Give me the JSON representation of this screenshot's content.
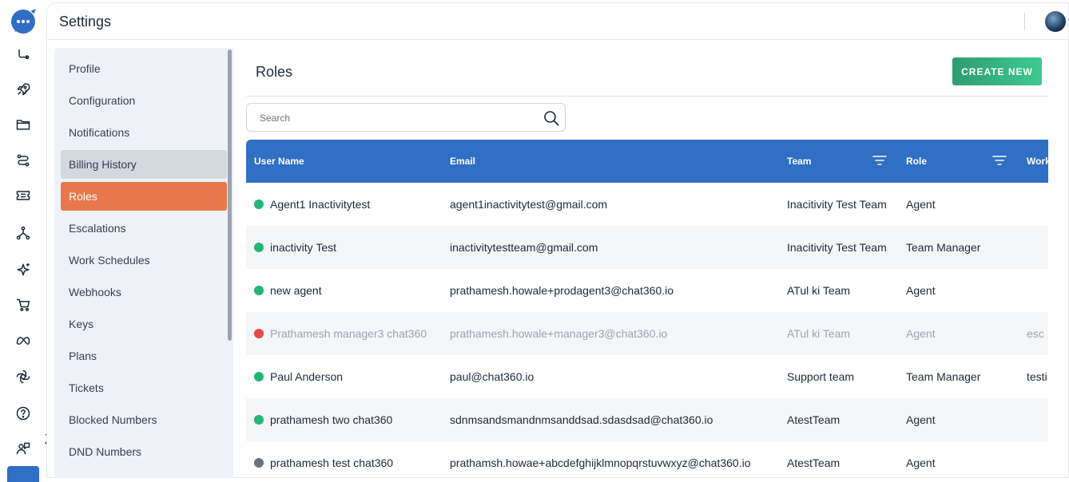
{
  "header": {
    "title": "Settings"
  },
  "colors": {
    "accent": "#e8784c",
    "header_blue": "#2f6fc4",
    "online": "#22b573",
    "offline": "#e5484d",
    "away": "#6b7280",
    "create_green": "#2f9c72"
  },
  "rail": {
    "icons": [
      "chat-logo-icon",
      "flow-icon",
      "rocket-icon",
      "folder-icon",
      "workflow-icon",
      "ticket-icon",
      "network-icon",
      "sparkle-icon",
      "cart-icon",
      "meta-icon",
      "openai-icon",
      "help-icon",
      "agent-support-icon"
    ]
  },
  "menu": {
    "items": [
      {
        "label": "Profile"
      },
      {
        "label": "Configuration"
      },
      {
        "label": "Notifications"
      },
      {
        "label": "Billing History"
      },
      {
        "label": "Roles"
      },
      {
        "label": "Escalations"
      },
      {
        "label": "Work Schedules"
      },
      {
        "label": "Webhooks"
      },
      {
        "label": "Keys"
      },
      {
        "label": "Plans"
      },
      {
        "label": "Tickets"
      },
      {
        "label": "Blocked Numbers"
      },
      {
        "label": "DND Numbers"
      }
    ],
    "active": "Roles",
    "hovered": "Billing History"
  },
  "main": {
    "title": "Roles",
    "create_label": "CREATE NEW",
    "search": {
      "placeholder": "Search",
      "value": ""
    }
  },
  "table": {
    "columns": {
      "user_name": "User Name",
      "email": "Email",
      "team": "Team",
      "role": "Role",
      "work": "Work"
    },
    "rows": [
      {
        "status": "online",
        "name": "Agent1 Inactivitytest",
        "email": "agent1inactivitytest@gmail.com",
        "team": "Inacitivity Test Team",
        "role": "Agent",
        "work": ""
      },
      {
        "status": "online",
        "name": "inactivity Test",
        "email": "inactivitytestteam@gmail.com",
        "team": "Inacitivity Test Team",
        "role": "Team Manager",
        "work": ""
      },
      {
        "status": "online",
        "name": "new agent",
        "email": "prathamesh.howale+prodagent3@chat360.io",
        "team": "ATul ki Team",
        "role": "Agent",
        "work": ""
      },
      {
        "status": "offline",
        "name": "Prathamesh manager3 chat360",
        "email": "prathamesh.howale+manager3@chat360.io",
        "team": "ATul ki Team",
        "role": "Agent",
        "work": "esc",
        "inactive": true
      },
      {
        "status": "online",
        "name": "Paul Anderson",
        "email": "paul@chat360.io",
        "team": "Support team",
        "role": "Team Manager",
        "work": "testi"
      },
      {
        "status": "online",
        "name": "prathamesh two chat360",
        "email": "sdnmsandsmandnmsanddsad.sdasdsad@chat360.io",
        "team": "AtestTeam",
        "role": "Agent",
        "work": ""
      },
      {
        "status": "away",
        "name": "prathamesh test chat360",
        "email": "prathamsh.howae+abcdefghijklmnopqrstuvwxyz@chat360.io",
        "team": "AtestTeam",
        "role": "Agent",
        "work": ""
      }
    ]
  }
}
